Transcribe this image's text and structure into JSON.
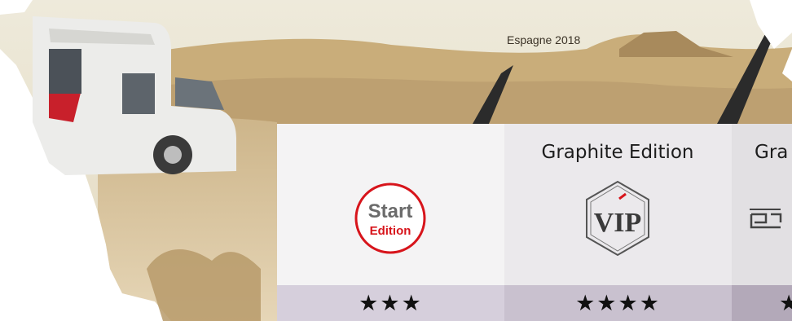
{
  "hero": {
    "caption": "Espagne 2018",
    "image": "camper-van-in-desert-photo"
  },
  "cards": [
    {
      "title": "",
      "logo_icon": "start-edition-logo",
      "logo_text_line1": "Start",
      "logo_text_line2": "Edition",
      "stars": 3
    },
    {
      "title": "Graphite Edition",
      "logo_icon": "vip-hexagon-logo",
      "logo_text": "VIP",
      "stars": 4
    },
    {
      "title": "Gra",
      "logo_icon": "partial-brand-logo",
      "stars": 1
    }
  ],
  "colors": {
    "start_red": "#d7141b",
    "star": "#111111",
    "sand": "#d8c49c",
    "sky": "#ece6d2"
  }
}
